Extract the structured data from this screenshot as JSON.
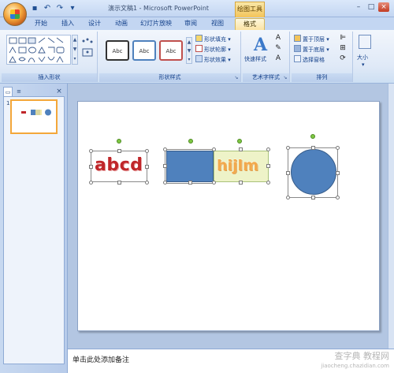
{
  "window": {
    "title": "演示文稿1 - Microsoft PowerPoint",
    "contextual_tab_group": "绘图工具",
    "controls": {
      "minimize": "–",
      "maximize": "□",
      "close": "×"
    }
  },
  "quick_access": [
    "save-icon",
    "undo-icon",
    "redo-icon",
    "customize-icon"
  ],
  "tabs": [
    "开始",
    "插入",
    "设计",
    "动画",
    "幻灯片放映",
    "审阅",
    "视图",
    "格式"
  ],
  "active_tab": "格式",
  "ribbon": {
    "insert_shapes": {
      "label": "插入形状"
    },
    "shape_styles": {
      "label": "形状样式",
      "presets": [
        "Abc",
        "Abc",
        "Abc"
      ],
      "fill": "形状填充",
      "outline": "形状轮廓",
      "effects": "形状效果"
    },
    "wordart": {
      "label": "艺术字样式",
      "quick_styles": "快速样式"
    },
    "arrange": {
      "label": "排列",
      "bring_front": "置于顶层",
      "send_back": "置于底层",
      "selection_pane": "选择窗格"
    },
    "size": {
      "label": "大小"
    }
  },
  "slide_panel": {
    "slide_number": "1"
  },
  "slide": {
    "text_box_1": "abcd",
    "text_box_2": "hijlm"
  },
  "notes": {
    "placeholder": "单击此处添加备注"
  },
  "watermark": {
    "line1": "查字典 教程网",
    "line2": "jiaocheng.chazidian.com"
  },
  "colors": {
    "shape_fill": "#4f81bd",
    "abcd_text": "#c0262a",
    "hijlm_text": "#f2a94b",
    "contextual_tab": "#f3c45a"
  }
}
